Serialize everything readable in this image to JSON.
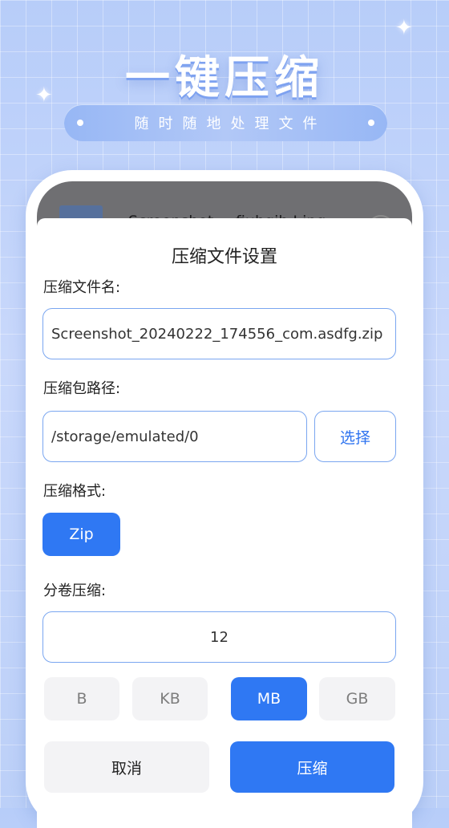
{
  "hero": {
    "title": "一键压缩",
    "subtitle": "随时随地处理文件"
  },
  "background_list": {
    "filename": "Screenshot_...fiuhgih.J.jpg"
  },
  "dialog": {
    "title": "压缩文件设置",
    "filename_label": "压缩文件名:",
    "filename_value": "Screenshot_20240222_174556_com.asdfg.zip",
    "path_label": "压缩包路径:",
    "path_value": "/storage/emulated/0",
    "choose_label": "选择",
    "format_label": "压缩格式:",
    "format_option": "Zip",
    "split_label": "分卷压缩:",
    "split_value": "12",
    "units": [
      "B",
      "KB",
      "MB",
      "GB"
    ],
    "selected_unit": "MB",
    "cancel_label": "取消",
    "compress_label": "压缩"
  },
  "colors": {
    "accent": "#2f78f3",
    "border": "#7aa6f0",
    "background": "#c9d8fb"
  }
}
